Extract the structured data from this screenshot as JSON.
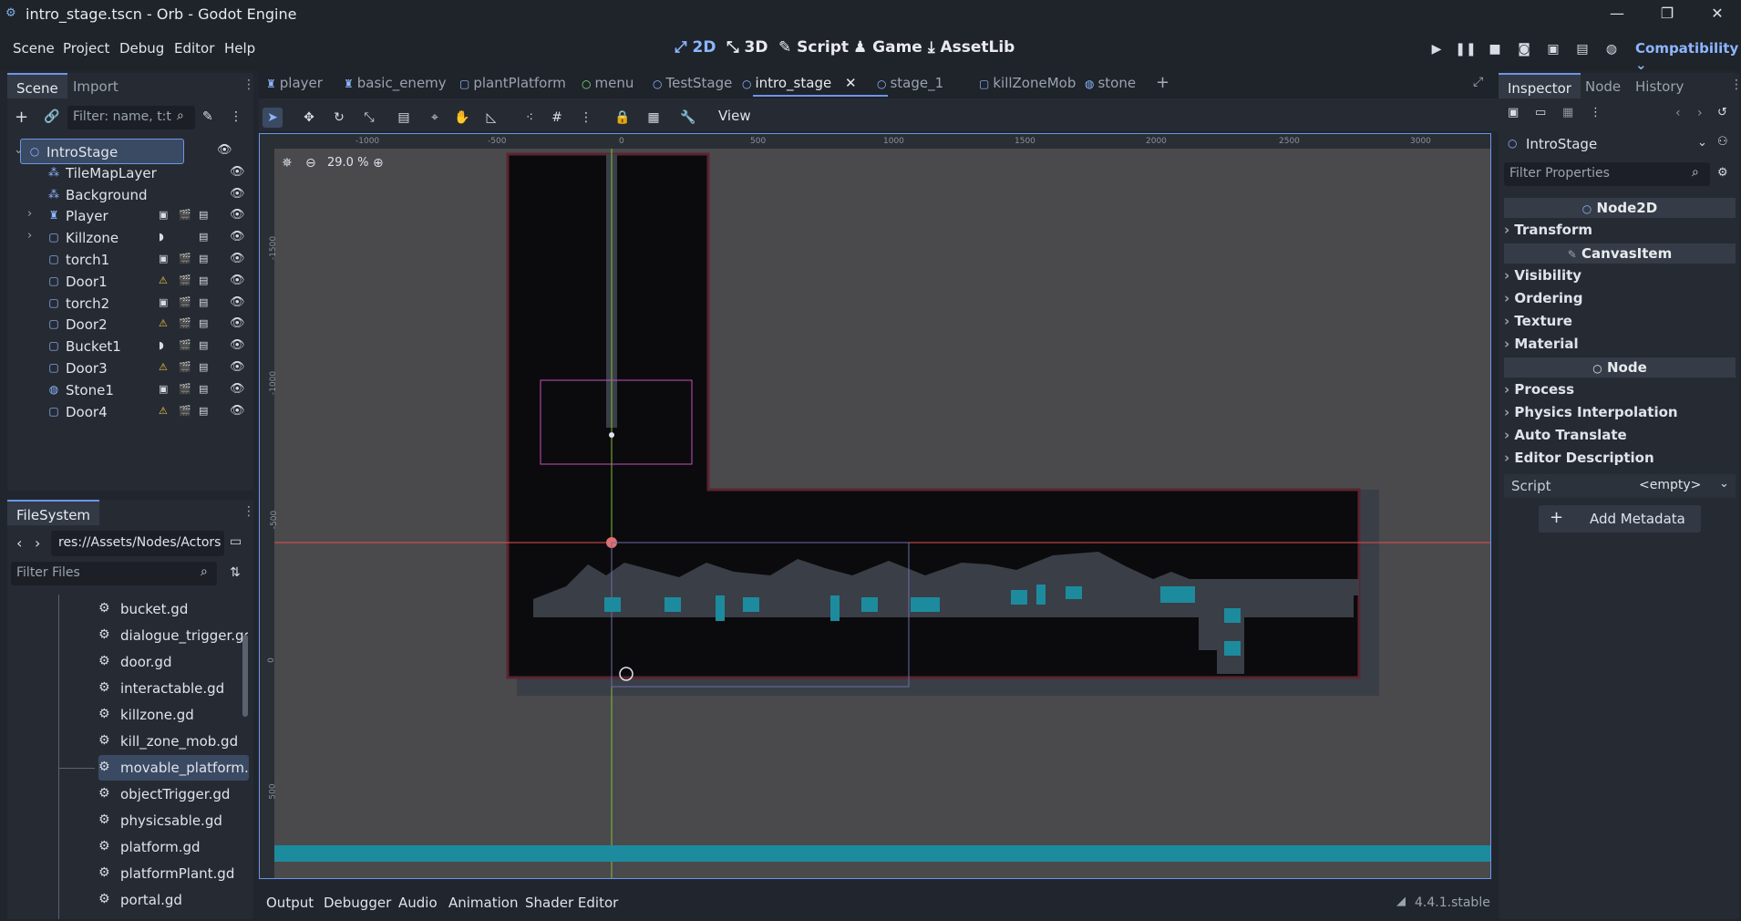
{
  "window": {
    "title": "intro_stage.tscn - Orb - Godot Engine"
  },
  "menu": [
    "Scene",
    "Project",
    "Debug",
    "Editor",
    "Help"
  ],
  "workspaces": [
    {
      "label": "2D",
      "icon": "2d-icon",
      "active": true
    },
    {
      "label": "3D",
      "icon": "3d-icon",
      "active": false
    },
    {
      "label": "Script",
      "icon": "script-icon",
      "active": false
    },
    {
      "label": "Game",
      "icon": "game-icon",
      "active": false
    },
    {
      "label": "AssetLib",
      "icon": "assetlib-icon",
      "active": false
    }
  ],
  "renderer": "Compatibility",
  "scene_dock": {
    "tabs": [
      "Scene",
      "Import"
    ],
    "filter_placeholder": "Filter: name, t:t",
    "nodes": [
      {
        "label": "IntroStage",
        "icon": "node2d-icon",
        "selected": true,
        "indent": 0
      },
      {
        "label": "TileMapLayer",
        "icon": "tilemap-icon",
        "indent": 1
      },
      {
        "label": "Background",
        "icon": "tilemap-icon",
        "indent": 1
      },
      {
        "label": "Player",
        "icon": "player-icon",
        "indent": 1,
        "expandable": true
      },
      {
        "label": "Killzone",
        "icon": "area-icon",
        "indent": 1,
        "expandable": true
      },
      {
        "label": "torch1",
        "icon": "area-icon",
        "indent": 1
      },
      {
        "label": "Door1",
        "icon": "area-icon",
        "indent": 1,
        "warning": true
      },
      {
        "label": "torch2",
        "icon": "area-icon",
        "indent": 1
      },
      {
        "label": "Door2",
        "icon": "area-icon",
        "indent": 1,
        "warning": true
      },
      {
        "label": "Bucket1",
        "icon": "area-icon",
        "indent": 1
      },
      {
        "label": "Door3",
        "icon": "area-icon",
        "indent": 1,
        "warning": true
      },
      {
        "label": "Stone1",
        "icon": "rigidbody-icon",
        "indent": 1
      },
      {
        "label": "Door4",
        "icon": "area-icon",
        "indent": 1,
        "warning": true
      }
    ]
  },
  "filesystem": {
    "tab": "FileSystem",
    "path": "res://Assets/Nodes/Actors",
    "filter_placeholder": "Filter Files",
    "files": [
      "bucket.gd",
      "dialogue_trigger.gd",
      "door.gd",
      "interactable.gd",
      "killzone.gd",
      "kill_zone_mob.gd",
      "movable_platform...",
      "objectTrigger.gd",
      "physicsable.gd",
      "platform.gd",
      "platformPlant.gd",
      "portal.gd"
    ],
    "selected_index": 6
  },
  "editor_tabs": [
    {
      "label": "player",
      "icon": "player-icon"
    },
    {
      "label": "basic_enemy",
      "icon": "player-icon"
    },
    {
      "label": "plantPlatform",
      "icon": "area-icon"
    },
    {
      "label": "menu",
      "icon": "control-icon"
    },
    {
      "label": "TestStage",
      "icon": "node2d-icon"
    },
    {
      "label": "intro_stage",
      "icon": "node2d-icon",
      "active": true
    },
    {
      "label": "stage_1",
      "icon": "node2d-icon"
    },
    {
      "label": "killZoneMob",
      "icon": "area-icon"
    },
    {
      "label": "stone",
      "icon": "rigidbody-icon"
    }
  ],
  "toolbar": {
    "view_label": "View"
  },
  "viewport": {
    "zoom": "29.0 %",
    "ruler_h": [
      "-1000",
      "-500",
      "0",
      "500",
      "1000",
      "1500",
      "2000",
      "2500",
      "3000"
    ],
    "ruler_v": [
      "-1500",
      "-1000",
      "-500",
      "0",
      "500"
    ]
  },
  "inspector": {
    "tabs": [
      "Inspector",
      "Node",
      "History"
    ],
    "node_name": "IntroStage",
    "filter_placeholder": "Filter Properties",
    "categories": [
      {
        "title": "Node2D",
        "sections": [
          "Transform"
        ]
      },
      {
        "title": "CanvasItem",
        "sections": [
          "Visibility",
          "Ordering",
          "Texture",
          "Material"
        ]
      },
      {
        "title": "Node",
        "sections": [
          "Process",
          "Physics Interpolation",
          "Auto Translate",
          "Editor Description"
        ]
      }
    ],
    "script_label": "Script",
    "script_value": "<empty>",
    "add_metadata": "Add Metadata"
  },
  "bottom_panel": {
    "tabs": [
      "Output",
      "Debugger",
      "Audio",
      "Animation",
      "Shader Editor"
    ],
    "version": "4.4.1.stable"
  },
  "colors": {
    "accent": "#8db6ff",
    "warning": "#f5c542",
    "canvas_bg": "#4a4a4d",
    "tiles": "#0b0b0d",
    "selection": "#3b4a63"
  }
}
